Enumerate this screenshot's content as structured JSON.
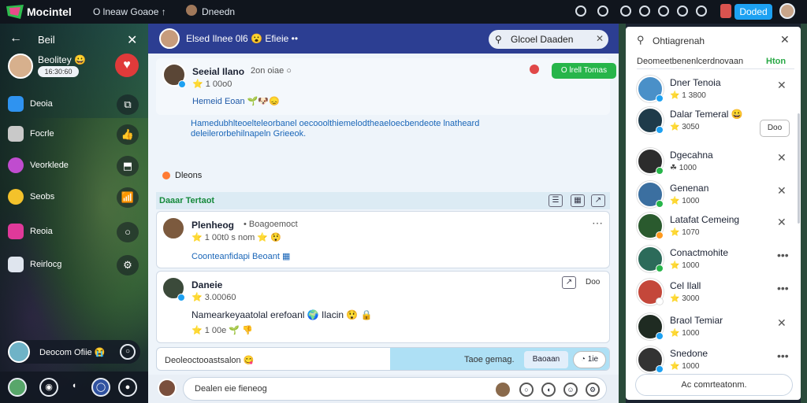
{
  "app": {
    "title": "Mocintel",
    "tab_a": "O lneaw Goaoe ↑",
    "tab_b": "Dneedn",
    "cta_label": "Doded"
  },
  "left": {
    "header_title": "Beil",
    "profile": {
      "name": "Beolitey 😀",
      "handle": "16:30:60"
    },
    "nav": [
      {
        "label": "Deoia",
        "icon": "chat-icon",
        "color": "#2f93f0",
        "right": "⧉"
      },
      {
        "label": "Focrle",
        "icon": "megaphone-icon",
        "color": "#c9c9c9",
        "right": "👍"
      },
      {
        "label": "Veorklede",
        "icon": "video-icon",
        "color": "#c04ccf",
        "right": "⬒"
      },
      {
        "label": "Seobs",
        "icon": "emoji-icon",
        "color": "#f4c22b",
        "right": "📶"
      },
      {
        "label": "Reoia",
        "icon": "media-icon",
        "color": "#e0399a",
        "right": "○"
      },
      {
        "label": "Reirlocg",
        "icon": "layers-icon",
        "color": "#dfe5ee",
        "right": "⚙"
      }
    ],
    "card_label": "Deocom Ofiie 😭"
  },
  "center": {
    "header_title": "Elsed Ilnee 0l6 😮 Efieie ••",
    "search_placeholder": "Glcoel Daaden",
    "post1": {
      "name": "Seeial Ilano",
      "meta": "2on oiae ○",
      "sub": "⭐ 1 00o0",
      "body": "Hemeid Eoan 🌱🐶😞",
      "text": "Hamedubhlteoelteleorbanel oecooolthiemelodtheaeloecbendeote lnatheard deleilerorbehilnapeln Grieeok.",
      "btn": "O lrell Tomas"
    },
    "reply_label": "Dleons",
    "section_label": "Daaar Tertaot",
    "post2": {
      "name": "Plenheog",
      "handle": "• Boagoemoct",
      "sub": "⭐ 1 00t0 s nom ⭐ 😲",
      "link": "Coonteanfidapi Beoant ▦"
    },
    "post3": {
      "name": "Daneie",
      "sub": "⭐ 3.00060",
      "body": "Namearkeyaatolal erefoanl 🌍 Ilacin 😲 🔒",
      "react": "⭐ 1 00e 🌱 👎",
      "right": "Doo"
    },
    "compose_left": "Deoleoctooastsalon 😋",
    "compose_right": "Taoe gemag.",
    "compose_btn": "Baoaan",
    "compose_count": "◔ 1ie",
    "footer_placeholder": "Dealen eie fieneog"
  },
  "right": {
    "search_placeholder": "Ohtiagrenah",
    "header": "Deomeetbenenlcerdnovaan",
    "header_right": "Hton",
    "users": [
      {
        "name": "Dner Tenoia",
        "sub": "⭐ 1 3800",
        "color": "#4a90c8",
        "action": "✕"
      },
      {
        "name": "Dalar Temeral 😀",
        "sub": "⭐ 3050",
        "color": "#1f3b4a",
        "action": "Doo"
      },
      {
        "name": "Dgecahna",
        "sub": "☘ 1000",
        "color": "#2c2c2c",
        "action": "✕"
      },
      {
        "name": "Genenan",
        "sub": "⭐ 1000",
        "color": "#3b6fa0",
        "action": "✕"
      },
      {
        "name": "Latafat Cemeing",
        "sub": "⭐ 1070",
        "color": "#2a5a2e",
        "action": "✕"
      },
      {
        "name": "Conactmohite",
        "sub": "⭐ 1000",
        "color": "#2c6b5a",
        "action": "•••"
      },
      {
        "name": "Cel Ilall",
        "sub": "⭐ 3000",
        "color": "#c4473a",
        "action": "•••"
      },
      {
        "name": "Braol Temiar",
        "sub": "⭐ 1000",
        "color": "#1f2b22",
        "action": "✕"
      },
      {
        "name": "Snedone",
        "sub": "⭐ 1000",
        "color": "#333333",
        "action": "•••"
      }
    ],
    "footer_label": "Ac comrteatonm."
  }
}
